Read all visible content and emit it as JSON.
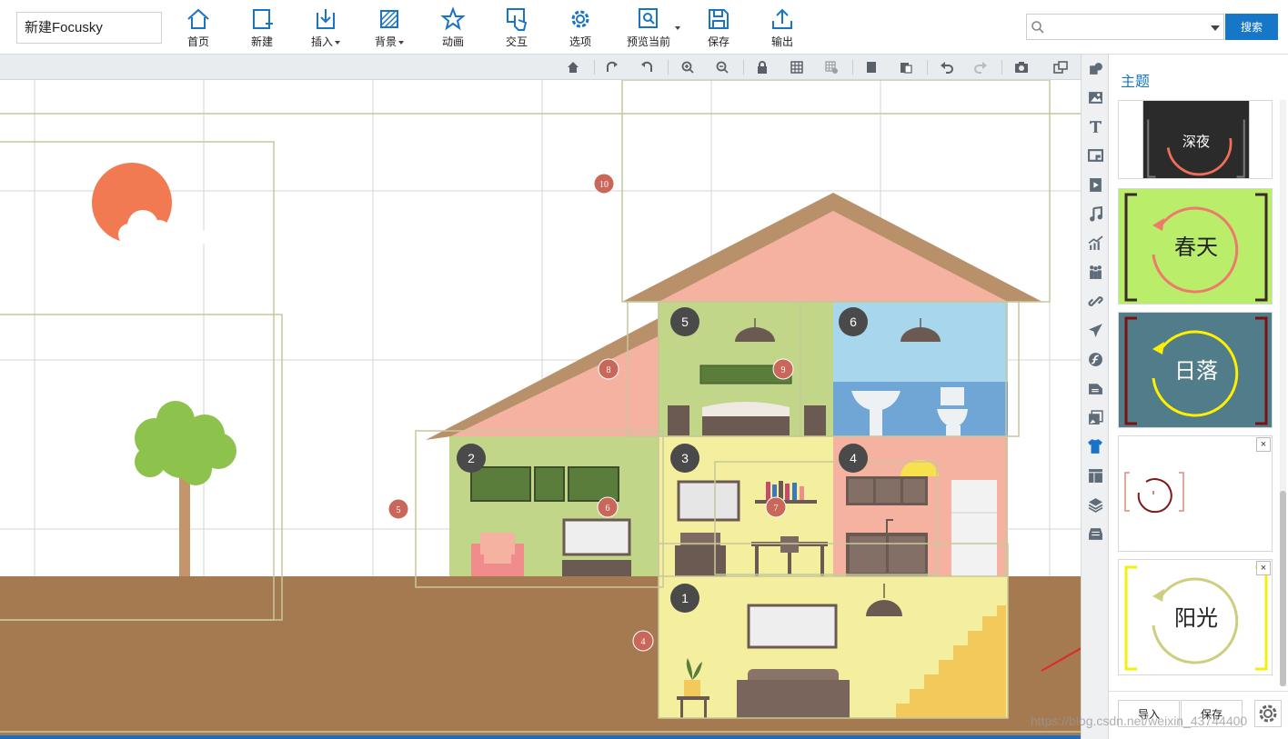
{
  "header": {
    "title": "新建Focusky",
    "toolbar": [
      {
        "id": "home",
        "label": "首页",
        "icon": "home-icon"
      },
      {
        "id": "new",
        "label": "新建",
        "icon": "new-page-icon"
      },
      {
        "id": "insert",
        "label": "插入",
        "icon": "insert-icon",
        "dropdown": true
      },
      {
        "id": "background",
        "label": "背景",
        "icon": "background-icon",
        "dropdown": true
      },
      {
        "id": "animation",
        "label": "动画",
        "icon": "star-animation-icon"
      },
      {
        "id": "interact",
        "label": "交互",
        "icon": "hand-click-icon"
      },
      {
        "id": "options",
        "label": "选项",
        "icon": "gear-icon"
      },
      {
        "id": "preview",
        "label": "预览当前",
        "icon": "preview-icon",
        "dropdown": true
      },
      {
        "id": "save",
        "label": "保存",
        "icon": "floppy-icon"
      },
      {
        "id": "export",
        "label": "输出",
        "icon": "upload-icon"
      }
    ],
    "search": {
      "placeholder": "",
      "button_label": "搜索"
    }
  },
  "canvas": {
    "frame_numbers": [
      "10",
      "8",
      "9",
      "6",
      "7",
      "5",
      "4"
    ],
    "room_numbers": [
      "1",
      "2",
      "3",
      "4",
      "5",
      "6"
    ]
  },
  "theme_panel": {
    "title": "主题",
    "themes": [
      {
        "name": "深夜",
        "bg": "#2b2b2b",
        "bracket": "#777777",
        "ring": "#ef6f57",
        "text": "#ffffff"
      },
      {
        "name": "春天",
        "bg": "#b9ed6a",
        "bracket": "#3a2a2a",
        "ring": "#ef7a6c",
        "text": "#222222"
      },
      {
        "name": "日落",
        "bg": "#517c8a",
        "bracket": "#7a1212",
        "ring": "#fff000",
        "text": "#ffffff"
      },
      {
        "name": "",
        "bg": "#ffffff",
        "bracket": "#d98b80",
        "ring": "#7a1a1a",
        "text": "#222222",
        "closable": true
      },
      {
        "name": "阳光",
        "bg": "#ffffff",
        "bracket": "#f4ef10",
        "ring": "#cdcf7e",
        "text": "#222222",
        "closable": true
      }
    ],
    "import_label": "导入",
    "save_label": "保存",
    "close_glyph": "×"
  },
  "watermark": "https://blog.csdn.net/weixin_43744400",
  "colors": {
    "accent": "#1677c9",
    "ground": "#a57a50",
    "roof": "#b8916a"
  }
}
